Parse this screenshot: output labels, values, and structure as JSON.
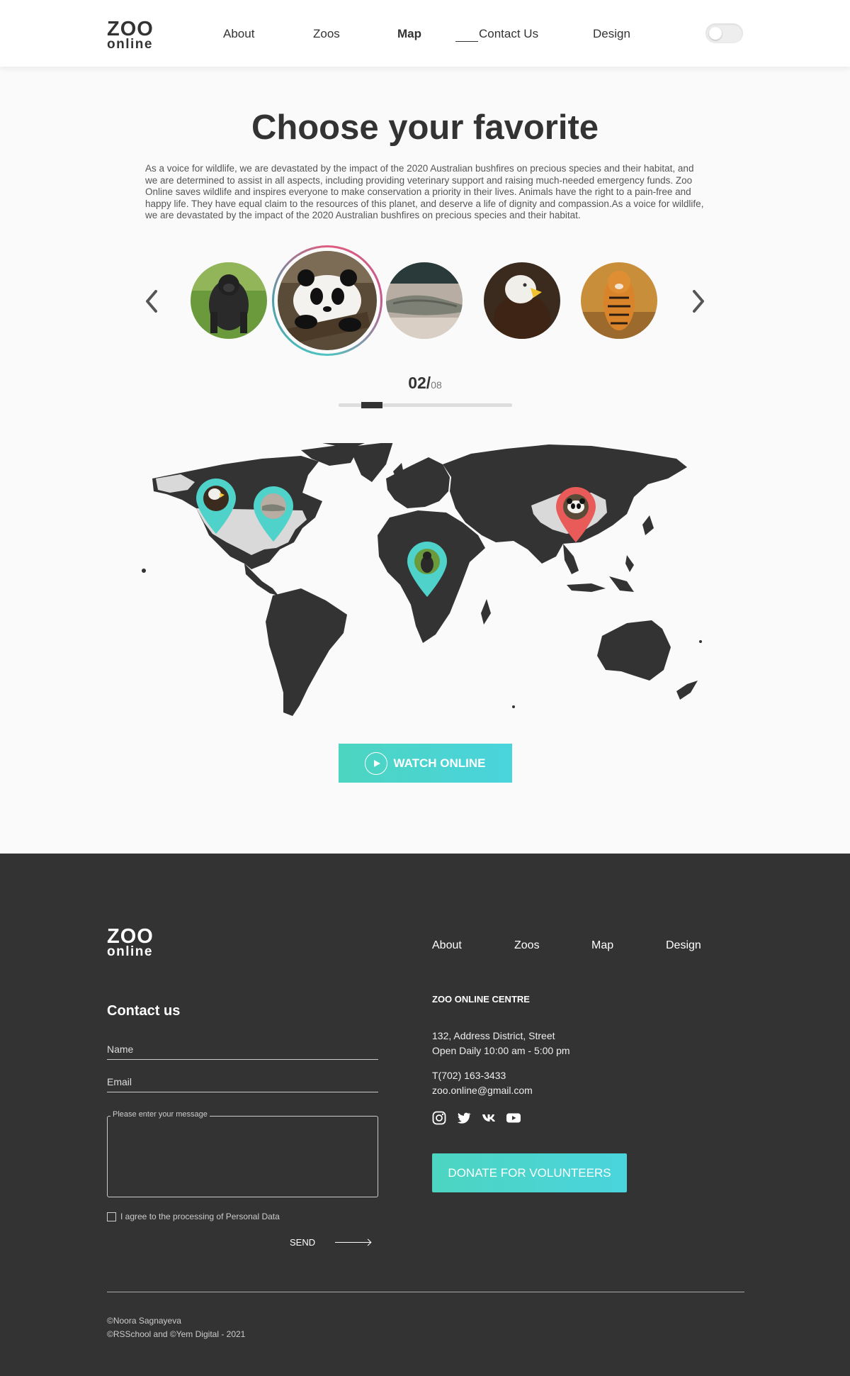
{
  "header": {
    "logo_line1": "ZOO",
    "logo_line2": "online",
    "nav": [
      {
        "label": "About"
      },
      {
        "label": "Zoos"
      },
      {
        "label": "Map",
        "active": true
      },
      {
        "label": "Contact Us"
      },
      {
        "label": "Design"
      }
    ],
    "theme_toggle": "off"
  },
  "main": {
    "title": "Choose your favorite",
    "description": "As a voice for wildlife, we are devastated by the impact of the 2020 Australian bushfires on precious species and their habitat, and we are determined to assist in all aspects, including providing veterinary support and raising much-needed emergency funds. Zoo Online saves wildlife and inspires everyone to make conservation a priority in their lives. Animals have the right to a pain-free and happy life. They have equal claim to the resources of this planet, and deserve a life of dignity and compassion.As a voice for wildlife, we are devastated by the impact of the 2020 Australian bushfires on precious species and their habitat.",
    "carousel": {
      "items": [
        "gorilla",
        "panda",
        "alligator",
        "eagle",
        "tiger"
      ],
      "selected_index": 1,
      "counter_current": "02/",
      "counter_total": "08",
      "progress_fraction": 0.25
    },
    "map_pins": [
      {
        "animal": "eagle",
        "color": "#4ed2c9"
      },
      {
        "animal": "alligator",
        "color": "#4ed2c9"
      },
      {
        "animal": "gorilla",
        "color": "#4ed2c9"
      },
      {
        "animal": "panda",
        "color": "#e95b59"
      }
    ],
    "watch_label": "WATCH ONLINE"
  },
  "footer": {
    "logo_line1": "ZOO",
    "logo_line2": "online",
    "nav": [
      {
        "label": "About"
      },
      {
        "label": "Zoos"
      },
      {
        "label": "Map"
      },
      {
        "label": "Design"
      }
    ],
    "contact_title": "Contact us",
    "name_placeholder": "Name",
    "email_placeholder": "Email",
    "message_placeholder": "Please enter your message",
    "agree_label": "I agree to the processing of Personal Data",
    "send_label": "SEND",
    "centre_title": "ZOO ONLINE CENTRE",
    "address": "132, Address District, Street",
    "hours": "Open Daily 10:00 am - 5:00 pm",
    "phone": "T(702) 163-3433",
    "email": "zoo.online@gmail.com",
    "social_icons": [
      "instagram-icon",
      "twitter-icon",
      "vk-icon",
      "youtube-icon"
    ],
    "donate_label": "DONATE FOR VOLUNTEERS",
    "copyright1": "©Noora Sagnayeva",
    "copyright2": "©RSSchool and ©Yem Digital - 2021"
  }
}
